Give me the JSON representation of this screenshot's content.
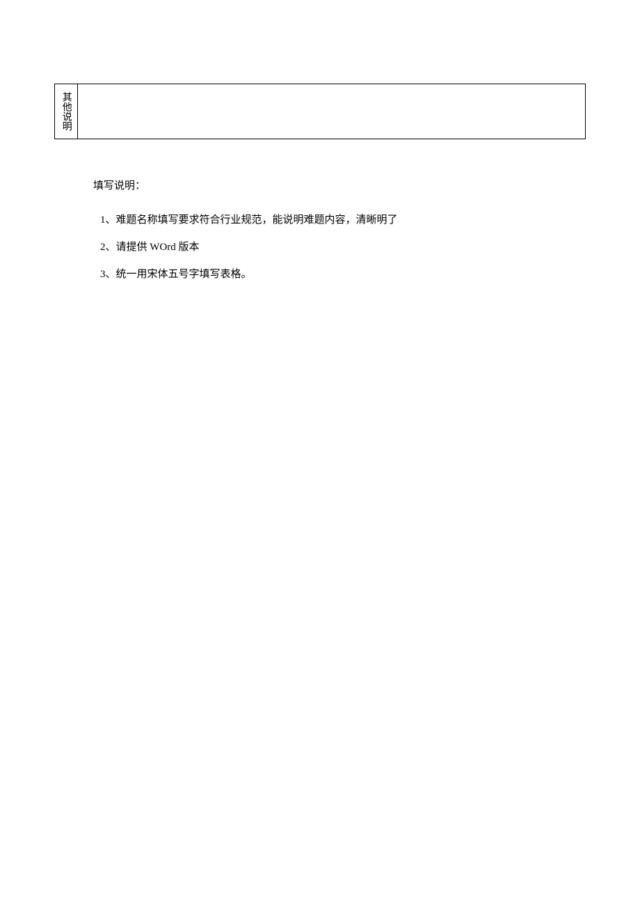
{
  "table": {
    "row_label": "其他说明",
    "row_content": ""
  },
  "instructions": {
    "heading": "填写说明：",
    "items": [
      "1、难题名称填写要求符合行业规范，能说明难题内容，清晰明了",
      "2、请提供 WOrd 版本",
      "3、统一用宋体五号字填写表格。"
    ]
  }
}
